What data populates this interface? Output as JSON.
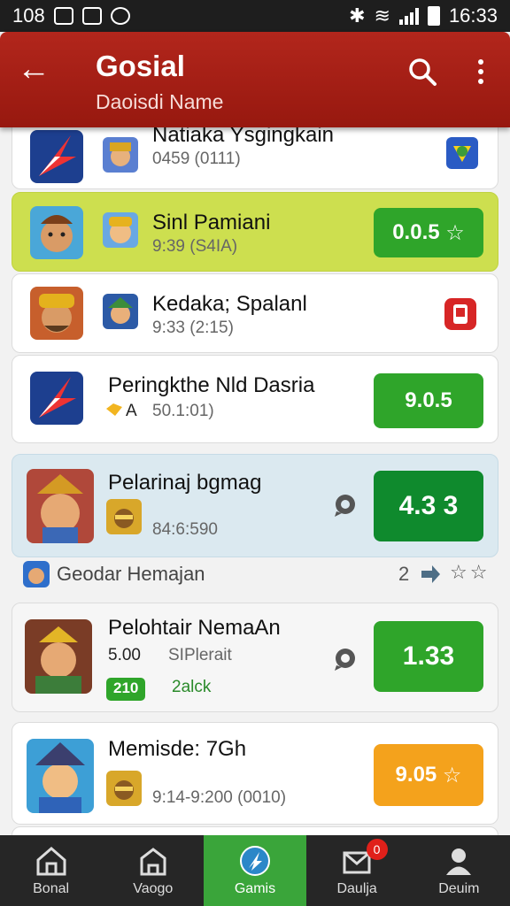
{
  "status_bar": {
    "time_left": "108",
    "time_right": "16:33"
  },
  "app_bar": {
    "title": "Gosial",
    "subtitle": "Daoisdi Name"
  },
  "cards": [
    {
      "name": "Natiaka Ysgingkain",
      "meta": "0459 (0111)",
      "score": ""
    },
    {
      "name": "Sinl Pamiani",
      "meta": "9:39 (S4IA)",
      "score": "0.0.5"
    },
    {
      "name": "Kedaka; Spalanl",
      "meta": "9:33 (2:15)",
      "score": ""
    },
    {
      "name": "Peringkthe Nld Dasria",
      "meta": "50.1:01)",
      "meta_prefix": "A",
      "score": "9.0.5"
    },
    {
      "name": "Pelarinaj bgmag",
      "meta": "84:6:590",
      "score": "4.3 3"
    },
    {
      "name": "Pelohtair NemaAn",
      "meta_prefix": "5.00",
      "meta": "SIPlerait",
      "tag": "210",
      "tag_text": "2alck",
      "score": "1.33"
    },
    {
      "name": "Memisde: 7Gh",
      "meta": "9:14-9:200 (0010)",
      "score": "9.05"
    }
  ],
  "section": {
    "label": "Geodar Hemajan",
    "count": "2"
  },
  "bottom_nav": [
    {
      "label": "Bonal",
      "active": false
    },
    {
      "label": "Vaogo",
      "active": false
    },
    {
      "label": "Gamis",
      "active": true
    },
    {
      "label": "Daulja",
      "active": false,
      "badge": "0"
    },
    {
      "label": "Deuim",
      "active": false
    }
  ],
  "colors": {
    "header": "#a81f16",
    "green": "#2fa52a",
    "lime": "#cddf4f",
    "orange": "#f4a21c"
  }
}
